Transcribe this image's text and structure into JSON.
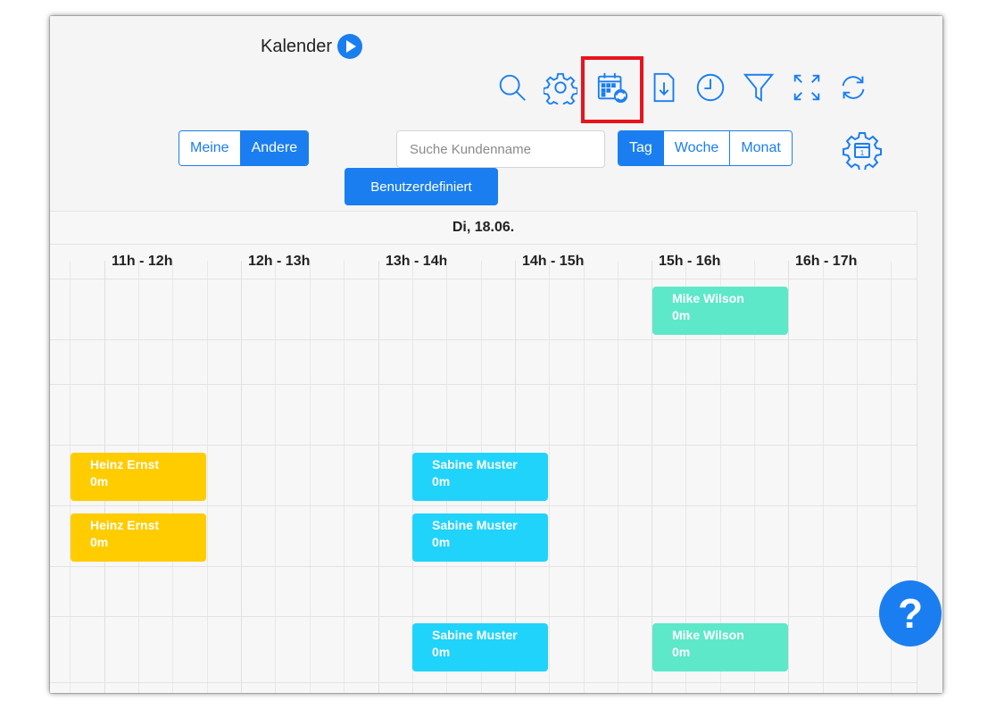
{
  "title": "Kalender",
  "view_owner": {
    "mine": "Meine",
    "others": "Andere",
    "active": "Andere"
  },
  "search": {
    "placeholder": "Suche Kundenname",
    "value": ""
  },
  "view_range": {
    "day": "Tag",
    "week": "Woche",
    "month": "Monat",
    "active": "Tag"
  },
  "custom_button": "Benutzerdefiniert",
  "toolbar_icons": [
    "search-icon",
    "settings-gear-icon",
    "calendar-sync-icon",
    "document-download-icon",
    "clock-icon",
    "filter-icon",
    "fullscreen-icon",
    "refresh-icon"
  ],
  "calendar": {
    "day_label": "Di, 18.06.",
    "hours": [
      "11h - 12h",
      "12h - 13h",
      "13h - 14h",
      "14h - 15h",
      "15h - 16h",
      "16h - 17h"
    ],
    "events": [
      {
        "name": "Mike Wilson",
        "duration": "0m",
        "color": "#5de8c9"
      },
      {
        "name": "Heinz Ernst",
        "duration": "0m",
        "color": "#ffcc00"
      },
      {
        "name": "Sabine Muster",
        "duration": "0m",
        "color": "#20d3fb"
      },
      {
        "name": "Heinz Ernst",
        "duration": "0m",
        "color": "#ffcc00"
      },
      {
        "name": "Sabine Muster",
        "duration": "0m",
        "color": "#20d3fb"
      },
      {
        "name": "Sabine Muster",
        "duration": "0m",
        "color": "#20d3fb"
      },
      {
        "name": "Mike Wilson",
        "duration": "0m",
        "color": "#5de8c9"
      }
    ]
  },
  "help_label": "?",
  "colors": {
    "accent": "#1a7ef0",
    "highlight": "#e8141c"
  }
}
